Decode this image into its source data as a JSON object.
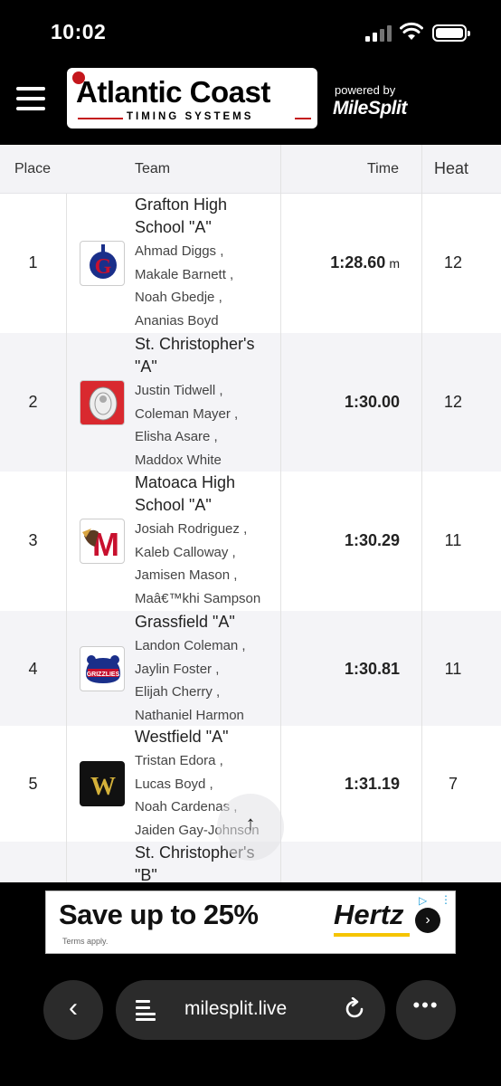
{
  "status_bar": {
    "time": "10:02"
  },
  "header": {
    "logo_title": "Atlantic Coast",
    "logo_subtitle": "TIMING SYSTEMS",
    "powered_by": "powered by",
    "brand": "MileSplit"
  },
  "table": {
    "columns": {
      "place": "Place",
      "team": "Team",
      "time": "Time",
      "heat": "Heat"
    },
    "rows": [
      {
        "place": "1",
        "team": "Grafton High School \"A\"",
        "athletes": [
          "Ahmad Diggs ,",
          "Makale Barnett ,",
          "Noah Gbedje ,",
          "Ananias Boyd"
        ],
        "time": "1:28.60",
        "unit": "m",
        "heat": "12",
        "logo_colors": [
          "#c8102e",
          "#1a2f8a"
        ]
      },
      {
        "place": "2",
        "team": "St. Christopher's \"A\"",
        "athletes": [
          "Justin Tidwell ,",
          "Coleman Mayer ,",
          "Elisha Asare ,",
          "Maddox White"
        ],
        "time": "1:30.00",
        "unit": "",
        "heat": "12",
        "logo_colors": [
          "#d9292f",
          "#ffffff"
        ]
      },
      {
        "place": "3",
        "team": "Matoaca High School \"A\"",
        "athletes": [
          "Josiah Rodriguez ,",
          "Kaleb Calloway ,",
          "Jamisen Mason ,",
          "Maâ€™khi Sampson"
        ],
        "time": "1:30.29",
        "unit": "",
        "heat": "11",
        "logo_colors": [
          "#c8102e",
          "#5a3a22"
        ]
      },
      {
        "place": "4",
        "team": "Grassfield \"A\"",
        "athletes": [
          "Landon Coleman ,",
          "Jaylin Foster ,",
          "Elijah Cherry ,",
          "Nathaniel Harmon"
        ],
        "time": "1:30.81",
        "unit": "",
        "heat": "11",
        "logo_colors": [
          "#c8102e",
          "#1a2f8a"
        ]
      },
      {
        "place": "5",
        "team": "Westfield \"A\"",
        "athletes": [
          "Tristan Edora ,",
          "Lucas Boyd ,",
          "Noah Cardenas ,",
          "Jaiden Gay-Johnson"
        ],
        "time": "1:31.19",
        "unit": "",
        "heat": "7",
        "logo_colors": [
          "#111111",
          "#d4b13a"
        ]
      },
      {
        "place": "",
        "team": "St. Christopher's \"B\"",
        "athletes": [],
        "time": "",
        "unit": "",
        "heat": ""
      }
    ]
  },
  "scroll_top": {
    "icon": "arrow-up-icon"
  },
  "ad": {
    "headline": "Save up to 25%",
    "terms": "Terms apply.",
    "brand": "Hertz",
    "brand_color": "#f5c400"
  },
  "browser": {
    "url": "milesplit.live"
  }
}
